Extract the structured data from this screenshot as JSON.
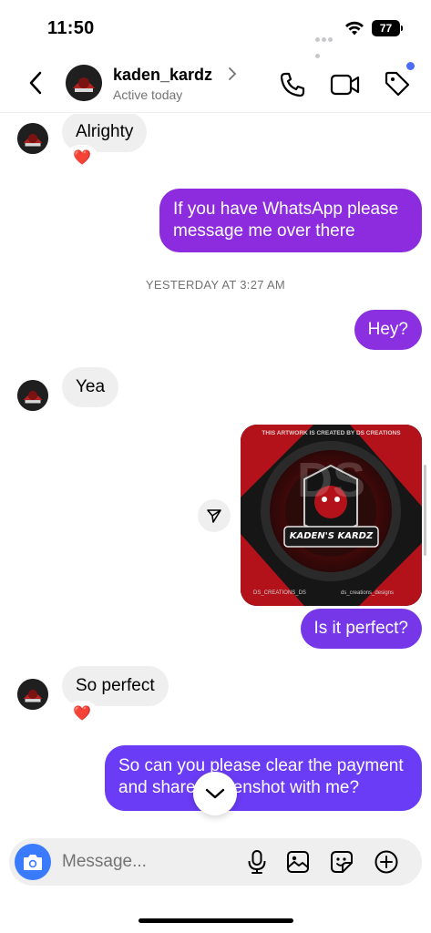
{
  "status_bar": {
    "time": "11:50",
    "battery": "77"
  },
  "header": {
    "username": "kaden_kardz",
    "status": "Active today",
    "icons": [
      "back-arrow-icon",
      "chevron-right-icon",
      "phone-icon",
      "video-camera-icon",
      "tag-icon"
    ]
  },
  "messages": [
    {
      "side": "in",
      "text": "Alrighty",
      "reaction": "❤️"
    },
    {
      "side": "out",
      "text": "If you have WhatsApp please message me over there"
    },
    {
      "side": "timestamp",
      "text": "YESTERDAY AT 3:27 AM"
    },
    {
      "side": "out",
      "text": "Hey?"
    },
    {
      "side": "in",
      "text": "Yea"
    },
    {
      "side": "out",
      "type": "image",
      "image_text": "KADEN'S KARDZ",
      "image_ring_text": "THIS ARTWORK IS CREATED BY DS CREATIONS",
      "image_footer_left": "DS_CREATIONS_DS",
      "image_footer_right": "ds_creations_designs",
      "image_watermark": "DS"
    },
    {
      "side": "out",
      "text": "Is it perfect?"
    },
    {
      "side": "in",
      "text": "So perfect",
      "reaction": "❤️"
    },
    {
      "side": "out",
      "text": "So can you please clear the payment and share screenshot with me?"
    }
  ],
  "composer": {
    "placeholder": "Message..."
  },
  "colors": {
    "outgoing_top": "#8a2be2",
    "outgoing_bottom": "#6b3cf5",
    "incoming": "#efefef",
    "accent_blue": "#3a7bfd",
    "reaction_red": "#e0245e"
  }
}
